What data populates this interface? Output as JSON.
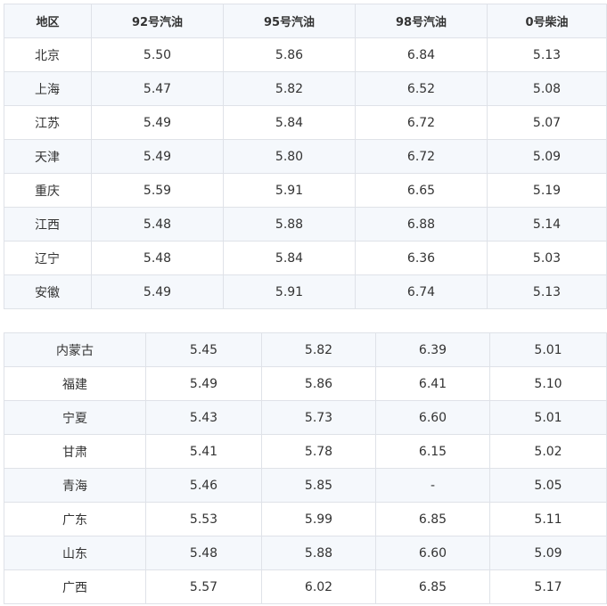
{
  "table_top": {
    "headers": [
      "地区",
      "92号汽油",
      "95号汽油",
      "98号汽油",
      "0号柴油"
    ],
    "rows": [
      [
        "北京",
        "5.50",
        "5.86",
        "6.84",
        "5.13"
      ],
      [
        "上海",
        "5.47",
        "5.82",
        "6.52",
        "5.08"
      ],
      [
        "江苏",
        "5.49",
        "5.84",
        "6.72",
        "5.07"
      ],
      [
        "天津",
        "5.49",
        "5.80",
        "6.72",
        "5.09"
      ],
      [
        "重庆",
        "5.59",
        "5.91",
        "6.65",
        "5.19"
      ],
      [
        "江西",
        "5.48",
        "5.88",
        "6.88",
        "5.14"
      ],
      [
        "辽宁",
        "5.48",
        "5.84",
        "6.36",
        "5.03"
      ],
      [
        "安徽",
        "5.49",
        "5.91",
        "6.74",
        "5.13"
      ]
    ]
  },
  "table_bottom": {
    "rows": [
      [
        "内蒙古",
        "5.45",
        "5.82",
        "6.39",
        "5.01"
      ],
      [
        "福建",
        "5.49",
        "5.86",
        "6.41",
        "5.10"
      ],
      [
        "宁夏",
        "5.43",
        "5.73",
        "6.60",
        "5.01"
      ],
      [
        "甘肃",
        "5.41",
        "5.78",
        "6.15",
        "5.02"
      ],
      [
        "青海",
        "5.46",
        "5.85",
        "-",
        "5.05"
      ],
      [
        "广东",
        "5.53",
        "5.99",
        "6.85",
        "5.11"
      ],
      [
        "山东",
        "5.48",
        "5.88",
        "6.60",
        "5.09"
      ],
      [
        "广西",
        "5.57",
        "6.02",
        "6.85",
        "5.17"
      ]
    ]
  },
  "colors": {
    "border": "#dfe2e8",
    "shade": "#f5f8fc",
    "text": "#333333"
  }
}
